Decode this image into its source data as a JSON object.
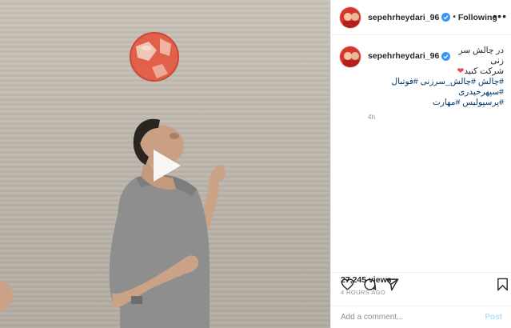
{
  "post": {
    "username": "sepehrheydari_96",
    "follow_separator": "•",
    "follow_label": "Following",
    "more_label": "•••"
  },
  "caption": {
    "username": "sepehrheydari_96",
    "line1": "در چالش سر زنی",
    "line2": "شرکت کنید",
    "heart": "❤",
    "line3_parts": [
      "#چالش",
      "#چالش_سرزنی",
      "#فوتبال",
      "#سپهرحیدری"
    ],
    "line4_parts": [
      "#پرسپولیس",
      "#مهارت"
    ],
    "time": "4h"
  },
  "stats": {
    "views": "27,245 views",
    "posted_ago": "4 HOURS AGO"
  },
  "comment": {
    "placeholder": "Add a comment...",
    "post_label": "Post"
  },
  "icons": {
    "play": "play-icon",
    "verified": "verified-badge-icon",
    "like": "heart-icon",
    "comment": "comment-icon",
    "share": "share-icon",
    "save": "bookmark-icon"
  },
  "colors": {
    "link": "#00376b",
    "verified": "#3897f0",
    "muted": "#8e8e8e",
    "post_disabled": "#b2dffc",
    "ball": "#e2604a"
  }
}
